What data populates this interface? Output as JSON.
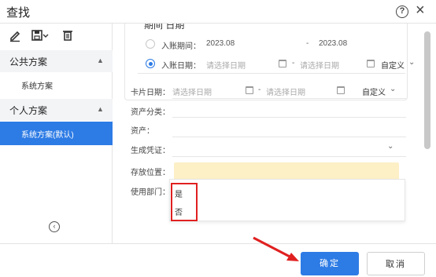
{
  "window": {
    "title": "查找"
  },
  "sidebar": {
    "sections": [
      {
        "label": "公共方案",
        "items": [
          {
            "label": "系统方案"
          }
        ]
      },
      {
        "label": "个人方案",
        "items": [
          {
            "label": "系统方案(默认)"
          }
        ]
      }
    ]
  },
  "period": {
    "title": "期间 日期",
    "row1": {
      "label": "入账期间：",
      "from": "2023.08",
      "to": "2023.08"
    },
    "row2": {
      "label": "入账日期：",
      "placeholder_from": "请选择日期",
      "placeholder_to": "请选择日期",
      "custom": "自定义"
    }
  },
  "fields": {
    "card_date": {
      "label": "卡片日期：",
      "placeholder_from": "请选择日期",
      "placeholder_to": "请选择日期",
      "custom": "自定义"
    },
    "asset_category": {
      "label": "资产分类："
    },
    "asset": {
      "label": "资产："
    },
    "voucher": {
      "label": "生成凭证："
    },
    "storage": {
      "label": "存放位置："
    },
    "department": {
      "label": "使用部门："
    }
  },
  "dropdown": {
    "options": [
      "是",
      "否"
    ]
  },
  "footer": {
    "ok": "确定",
    "cancel": "取消"
  },
  "colors": {
    "accent": "#2d7be5",
    "highlight": "#e02020",
    "input_bg": "#fdf0c7"
  }
}
